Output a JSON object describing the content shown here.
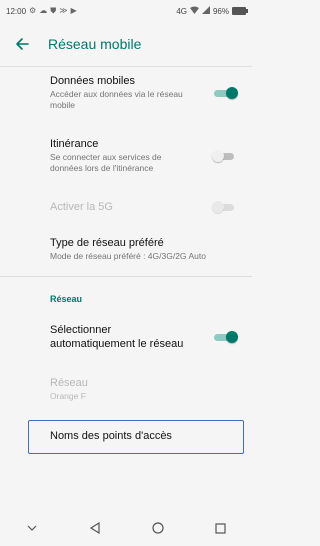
{
  "status_bar": {
    "time": "12:00",
    "signal": "4G",
    "battery_text": "96%",
    "battery_level": 0.96,
    "icons": [
      "settings-icon",
      "cloud-icon",
      "shield-icon",
      "signal-icon",
      "play-icon"
    ]
  },
  "app_bar": {
    "title": "Réseau mobile",
    "back_icon": "arrow-left-icon"
  },
  "settings": {
    "mobile_data": {
      "title": "Données mobiles",
      "subtitle": "Accéder aux données via le réseau mobile",
      "enabled": true
    },
    "roaming": {
      "title": "Itinérance",
      "subtitle": "Se connecter aux services de données lors de l'itinérance",
      "enabled": false
    },
    "enable_5g": {
      "title": "Activer la 5G",
      "enabled": false
    },
    "preferred_network": {
      "title": "Type de réseau préféré",
      "subtitle": "Mode de réseau préféré : 4G/3G/2G Auto"
    }
  },
  "network_section": {
    "header": "Réseau",
    "auto_select": {
      "title": "Sélectionner automatiquement le réseau",
      "enabled": true
    },
    "network": {
      "title": "Réseau",
      "subtitle": "Orange F"
    },
    "apn": {
      "title": "Noms des points d'accès"
    }
  },
  "colors": {
    "accent": "#00796b",
    "highlight": "#3f6fc2"
  },
  "nav_bar": {
    "icons": [
      "chevron-down-icon",
      "back-triangle-icon",
      "home-circle-icon",
      "recents-square-icon"
    ]
  }
}
